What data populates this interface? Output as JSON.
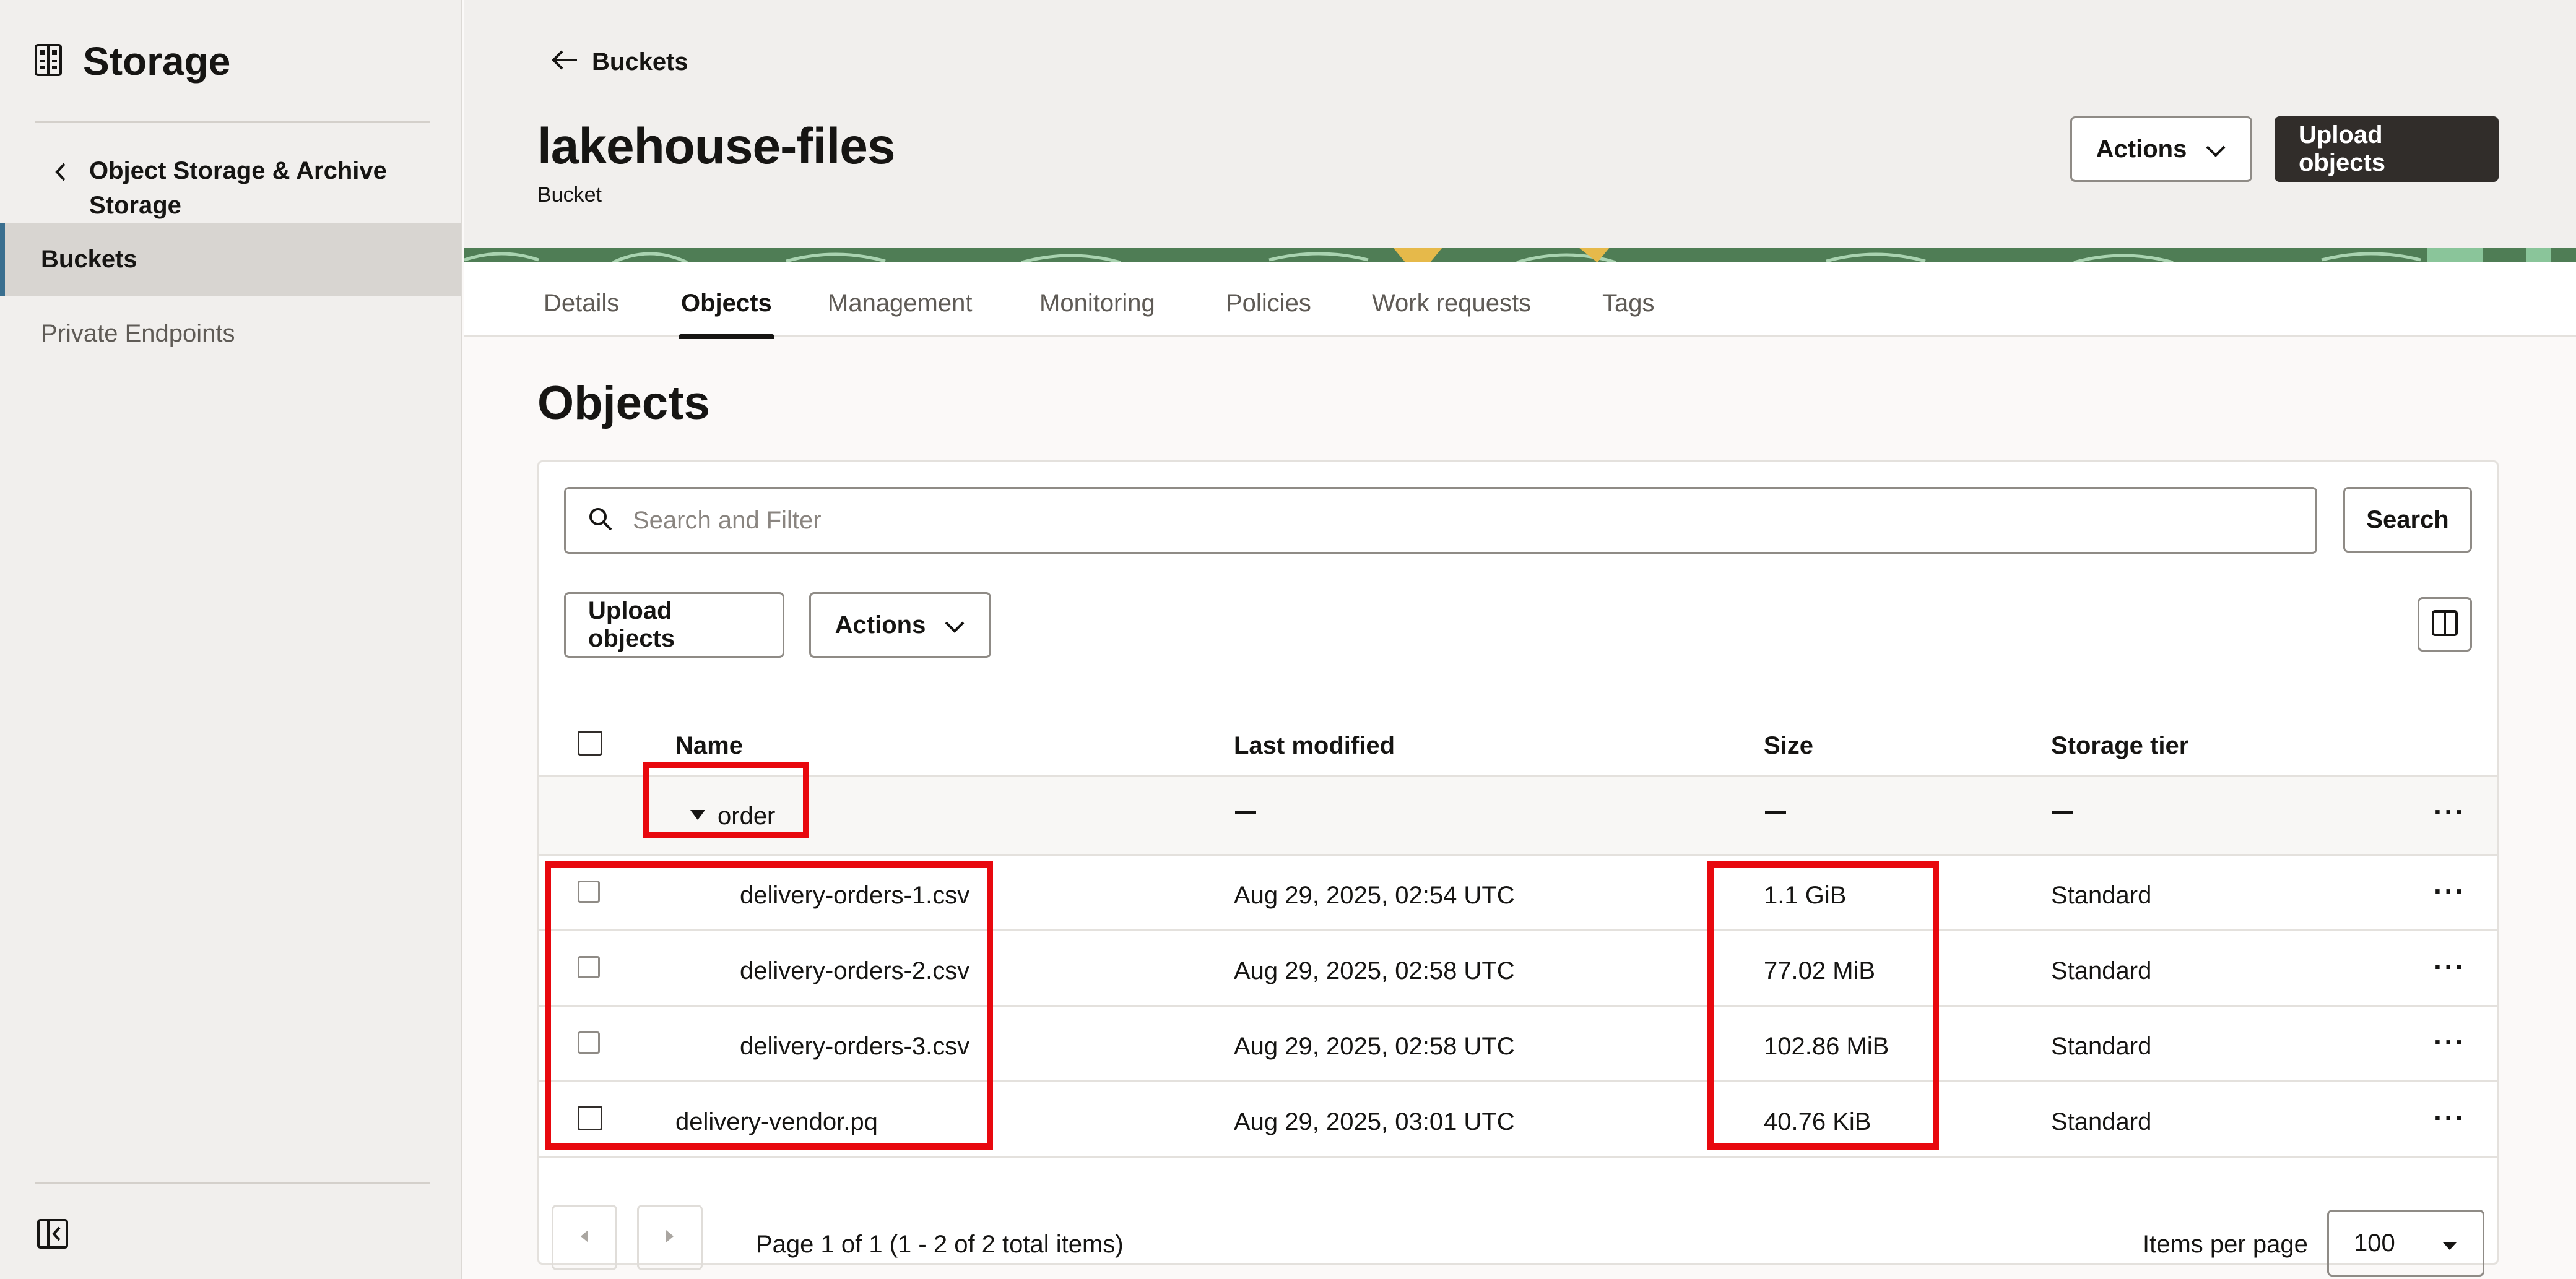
{
  "sidebar": {
    "title": "Storage",
    "parent_label": "Object Storage & Archive Storage",
    "items": [
      {
        "label": "Buckets",
        "active": true
      },
      {
        "label": "Private Endpoints",
        "active": false
      }
    ]
  },
  "header": {
    "back_label": "Buckets",
    "title": "lakehouse-files",
    "subtitle": "Bucket",
    "actions_label": "Actions",
    "upload_label": "Upload objects"
  },
  "tabs": [
    {
      "label": "Details",
      "active": false
    },
    {
      "label": "Objects",
      "active": true
    },
    {
      "label": "Management",
      "active": false
    },
    {
      "label": "Monitoring",
      "active": false
    },
    {
      "label": "Policies",
      "active": false
    },
    {
      "label": "Work requests",
      "active": false
    },
    {
      "label": "Tags",
      "active": false
    }
  ],
  "objects": {
    "title": "Objects",
    "search_placeholder": "Search and Filter",
    "search_button": "Search",
    "upload_button": "Upload objects",
    "actions_button": "Actions",
    "columns": {
      "name": "Name",
      "last_modified": "Last modified",
      "size": "Size",
      "tier": "Storage tier"
    },
    "folder": {
      "name": "order"
    },
    "rows": [
      {
        "name": "delivery-orders-1.csv",
        "modified": "Aug 29, 2025, 02:54 UTC",
        "size": "1.1 GiB",
        "tier": "Standard"
      },
      {
        "name": "delivery-orders-2.csv",
        "modified": "Aug 29, 2025, 02:58 UTC",
        "size": "77.02 MiB",
        "tier": "Standard"
      },
      {
        "name": "delivery-orders-3.csv",
        "modified": "Aug 29, 2025, 02:58 UTC",
        "size": "102.86 MiB",
        "tier": "Standard"
      },
      {
        "name": "delivery-vendor.pq",
        "modified": "Aug 29, 2025, 03:01 UTC",
        "size": "40.76 KiB",
        "tier": "Standard"
      }
    ],
    "pagination": {
      "text": "Page 1 of 1 (1 - 2 of 2 total items)",
      "items_per_page_label": "Items per page",
      "items_per_page": "100"
    }
  },
  "colors": {
    "highlight": "#e8080e",
    "primary_button": "#312d2a",
    "accent": "#3a6f8f"
  }
}
